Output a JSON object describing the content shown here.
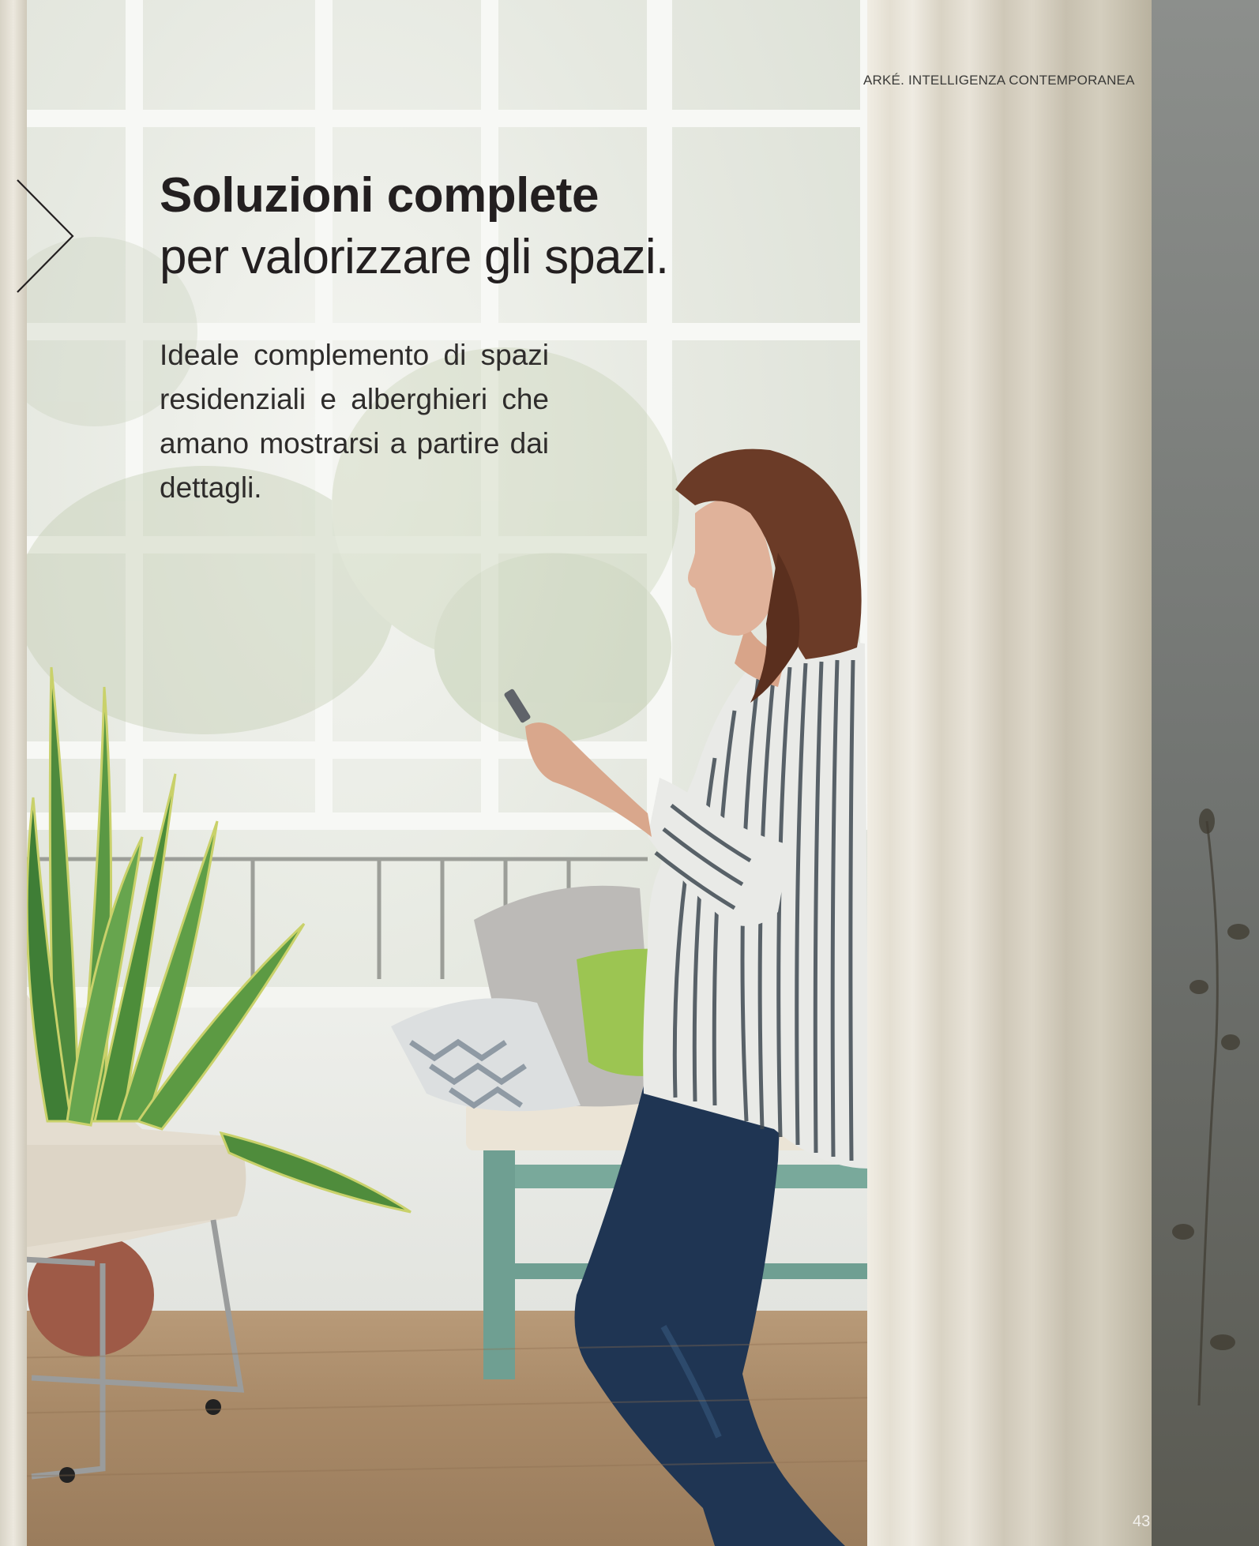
{
  "running_head": "ARKÉ. INTELLIGENZA CONTEMPORANEA",
  "headline": {
    "bold": "Soluzioni complete",
    "light": "per valorizzare gli spazi."
  },
  "body": "Ideale complemento di spazi residenziali e alberghieri che amano mostrarsi a partire dai dettagli.",
  "page_number": "43",
  "photo": {
    "icon": "photo-woman-with-smartphone-by-window"
  },
  "colors": {
    "text": "#231f20",
    "page_number": "#f2f0ec"
  }
}
